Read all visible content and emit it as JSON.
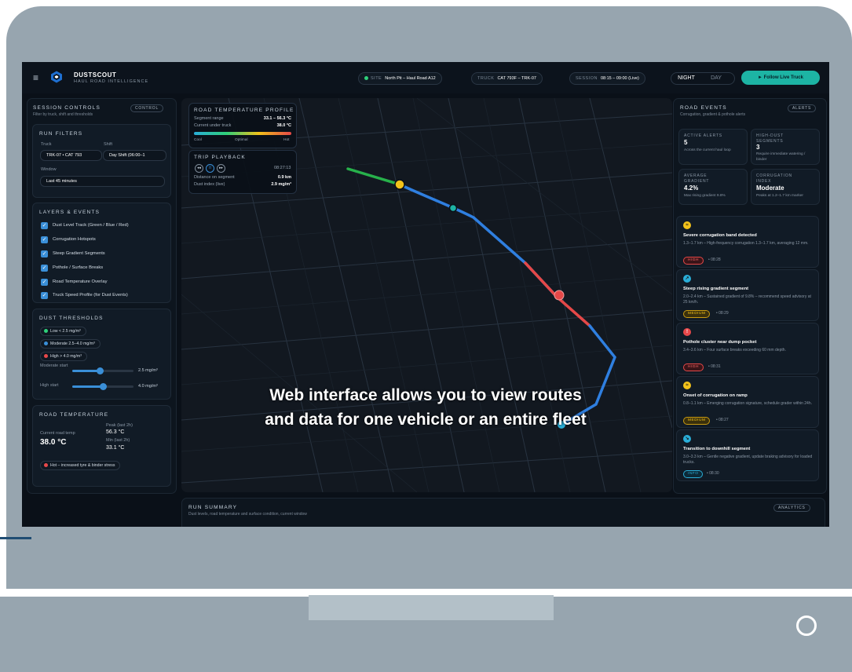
{
  "caption": {
    "line1": "Web interface allows you to view routes",
    "line2": "and data for one vehicle or an entire fleet"
  },
  "app": {
    "name": "DUSTSCOUT",
    "tagline": "HAUL ROAD INTELLIGENCE"
  },
  "topbar": {
    "site": {
      "key": "SITE",
      "value": "North Pit – Haul Road A12"
    },
    "truck": {
      "key": "TRUCK",
      "value": "CAT 793F – TRK-07"
    },
    "session": {
      "key": "SESSION",
      "value": "08:15 – 09:00 (Live)"
    },
    "night": "NIGHT",
    "day": "DAY",
    "follow": "► Follow Live Truck"
  },
  "session_controls": {
    "title": "SESSION CONTROLS",
    "tag": "CONTROL",
    "subtitle": "Filter by truck, shift and thresholds",
    "run_filters": {
      "title": "RUN FILTERS",
      "truck_label": "Truck",
      "truck_value": "TRK-07 • CAT 793",
      "shift_label": "Shift",
      "shift_value": "Day Shift (06:00–1",
      "window_label": "Window",
      "window_value": "Last 45 minutes"
    },
    "layers": {
      "title": "LAYERS & EVENTS",
      "items": [
        "Dust Level Track (Green / Blue / Red)",
        "Corrugation Hotspots",
        "Steep Gradient Segments",
        "Pothole / Surface Breaks",
        "Road Temperature Overlay",
        "Truck Speed Profile (for Dust Events)"
      ]
    },
    "dust": {
      "title": "DUST THRESHOLDS",
      "low": "Low < 2.5 mg/m³",
      "moderate": "Moderate 2.5–4.0 mg/m³",
      "high": "High > 4.0 mg/m³",
      "moderate_start_label": "Moderate start",
      "moderate_start_value": "2.5 mg/m³",
      "moderate_start_level": 0.45,
      "high_start_label": "High start",
      "high_start_value": "4.0 mg/m³",
      "high_start_level": 0.5
    },
    "road_temp": {
      "title": "ROAD TEMPERATURE",
      "current_label": "Current road temp",
      "current_value": "38.0 °C",
      "peak_label": "Peak (last 2h)",
      "peak_value": "56.3 °C",
      "min_label": "Min (last 2h)",
      "min_value": "33.1 °C",
      "status": "Hot – increased tyre & binder stress"
    }
  },
  "map": {
    "temp_profile": {
      "title": "ROAD TEMPERATURE PROFILE",
      "segment_label": "Segment range",
      "segment_value": "33.1 – 56.3 °C",
      "current_label": "Current under truck",
      "current_value": "38.0 °C",
      "scale": [
        "Cool",
        "Optimal",
        "Hot"
      ]
    },
    "playback": {
      "title": "TRIP PLAYBACK",
      "time": "08:27:13",
      "distance_label": "Distance on segment",
      "distance_value": "0.9 km",
      "dust_label": "Dust index (live)",
      "dust_value": "2.9 mg/m³"
    }
  },
  "road_events": {
    "title": "ROAD EVENTS",
    "tag": "ALERTS",
    "subtitle": "Corrugation, gradient & pothole alerts",
    "stats": [
      {
        "title": "ACTIVE ALERTS",
        "value": "5",
        "desc": "Across the current haul loop"
      },
      {
        "title": "HIGH-DUST SEGMENTS",
        "value": "3",
        "desc": "Require immediate watering / binder"
      },
      {
        "title": "AVERAGE GRADIENT",
        "value": "4.2%",
        "desc": "Max rising gradient 9.8%"
      },
      {
        "title": "CORRUGATION INDEX",
        "value": "Moderate",
        "desc": "Peaks at 1.2–1.7 km marker"
      }
    ],
    "events": [
      {
        "icon": "≈",
        "color": "#f2c21a",
        "title": "Severe corrugation band detected",
        "desc": "1.3–1.7 km – High-frequency corrugation 1.3–1.7 km, averaging 12 mm.",
        "severity": "HIGH",
        "time": "• 08:28"
      },
      {
        "icon": "↗",
        "color": "#2aaed8",
        "title": "Steep rising gradient segment",
        "desc": "2.0–2.4 km – Sustained gradient of 9.8% – recommend speed advisory at 25 km/h.",
        "severity": "MEDIUM",
        "time": "• 08:29"
      },
      {
        "icon": "!",
        "color": "#e8484a",
        "title": "Pothole cluster near dump pocket",
        "desc": "3.4–3.6 km – Four surface breaks exceeding 60 mm depth.",
        "severity": "HIGH",
        "time": "• 08:31"
      },
      {
        "icon": "≈",
        "color": "#f2c21a",
        "title": "Onset of corrugation on ramp",
        "desc": "0.8–1.1 km – Emerging corrugation signature, schedule grader within 24h.",
        "severity": "MEDIUM",
        "time": "• 08:27"
      },
      {
        "icon": "↘",
        "color": "#2aaed8",
        "title": "Transition to downhill segment",
        "desc": "3.0–3.3 km – Gentle negative gradient, update braking advisory for loaded trucks.",
        "severity": "INFO",
        "time": "• 08:30"
      }
    ]
  },
  "run_summary": {
    "title": "RUN SUMMARY",
    "tag": "ANALYTICS",
    "subtitle": "Dust levels, road temperature and surface condition, current window"
  }
}
